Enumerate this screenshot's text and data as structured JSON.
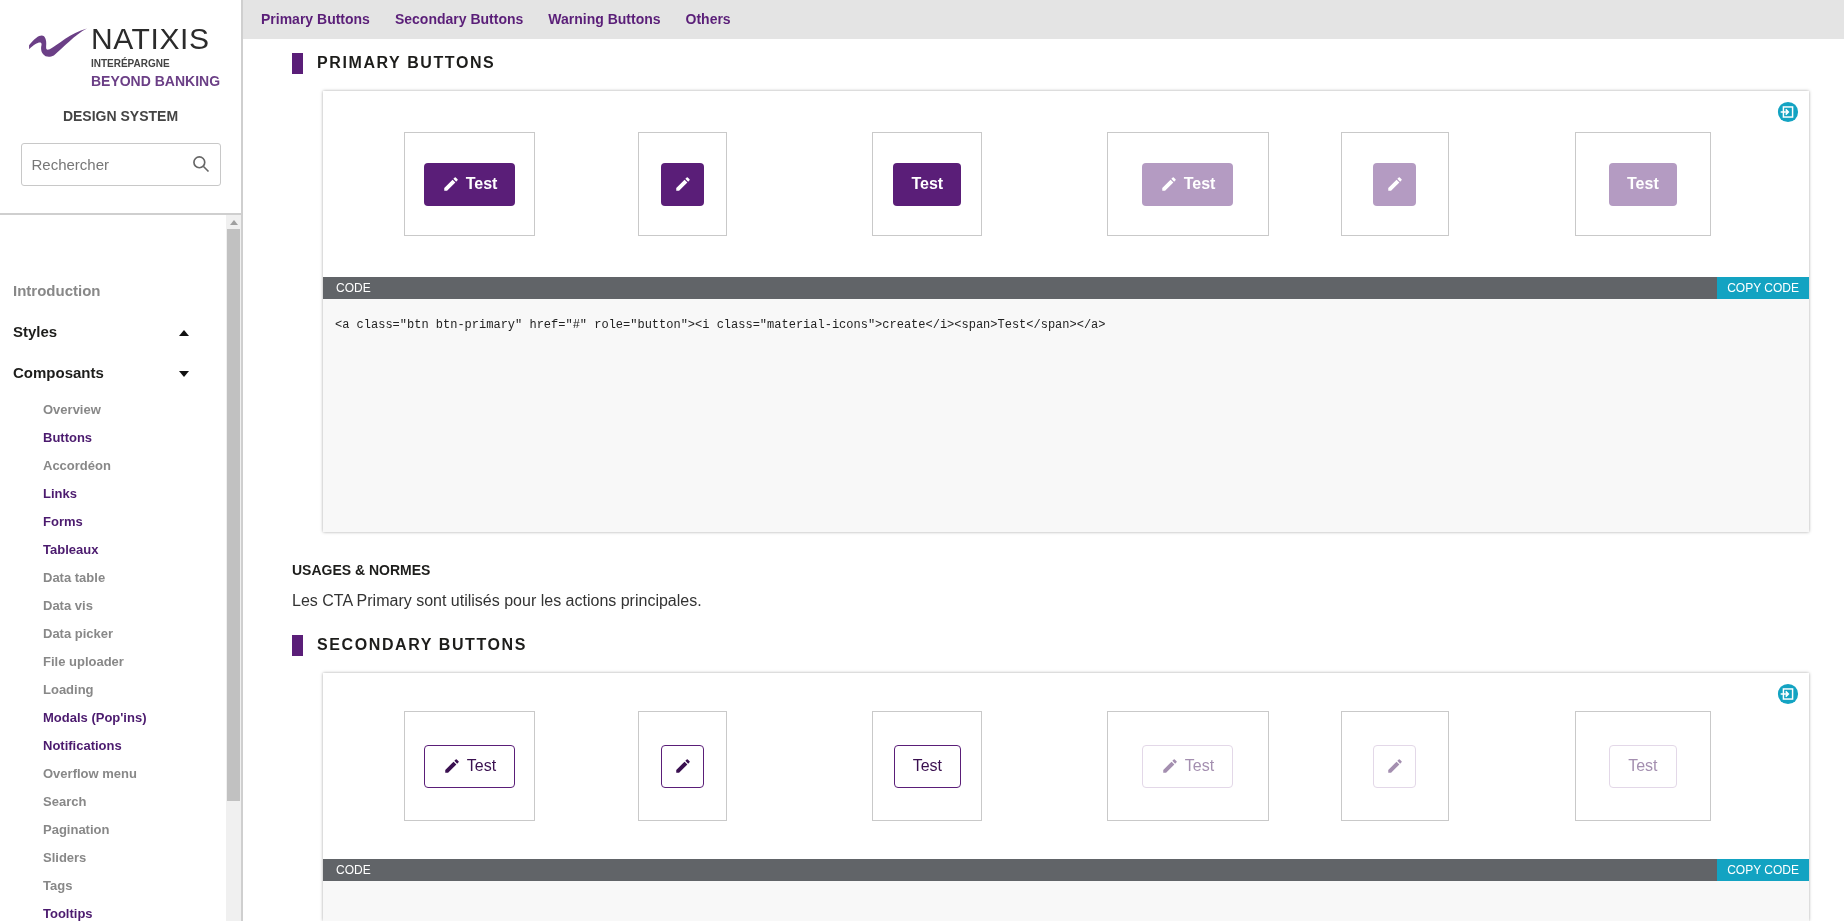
{
  "logo": {
    "name": "NATIXIS",
    "subtitle": "INTERÉPARGNE",
    "tagline": "BEYOND BANKING"
  },
  "sidebar": {
    "title": "DESIGN SYSTEM",
    "search": {
      "placeholder": "Rechercher"
    },
    "items": [
      {
        "kind": "link",
        "label": "Introduction"
      },
      {
        "kind": "group",
        "label": "Styles",
        "expanded": false
      },
      {
        "kind": "group",
        "label": "Composants",
        "expanded": true,
        "children": [
          {
            "label": "Overview",
            "visited": false
          },
          {
            "label": "Buttons",
            "visited": true
          },
          {
            "label": "Accordéon",
            "visited": false
          },
          {
            "label": "Links",
            "visited": true
          },
          {
            "label": "Forms",
            "visited": true
          },
          {
            "label": "Tableaux",
            "visited": true
          },
          {
            "label": "Data table",
            "visited": false
          },
          {
            "label": "Data vis",
            "visited": false
          },
          {
            "label": "Data picker",
            "visited": false
          },
          {
            "label": "File uploader",
            "visited": false
          },
          {
            "label": "Loading",
            "visited": false
          },
          {
            "label": "Modals (Pop'ins)",
            "visited": true
          },
          {
            "label": "Notifications",
            "visited": true
          },
          {
            "label": "Overflow menu",
            "visited": false
          },
          {
            "label": "Search",
            "visited": false
          },
          {
            "label": "Pagination",
            "visited": false
          },
          {
            "label": "Sliders",
            "visited": false
          },
          {
            "label": "Tags",
            "visited": false
          },
          {
            "label": "Tooltips",
            "visited": true
          }
        ]
      }
    ]
  },
  "top_nav": [
    "Primary Buttons",
    "Secondary Buttons",
    "Warning Buttons",
    "Others"
  ],
  "sections": [
    {
      "title": "PRIMARY BUTTONS",
      "kind": "primary",
      "demos": [
        {
          "kind": "icon_text",
          "label": "Test",
          "disabled": false
        },
        {
          "kind": "icon",
          "disabled": false
        },
        {
          "kind": "text",
          "label": "Test",
          "disabled": false
        },
        {
          "kind": "icon_text",
          "label": "Test",
          "disabled": true
        },
        {
          "kind": "icon",
          "disabled": true
        },
        {
          "kind": "text",
          "label": "Test",
          "disabled": true
        }
      ],
      "code_label": "CODE",
      "copy_label": "COPY CODE",
      "code": "<a class=\"btn btn-primary\" href=\"#\" role=\"button\"><i class=\"material-icons\">create</i><span>Test</span></a>",
      "usage_title": "USAGES & NORMES",
      "usage_text": "Les CTA Primary sont utilisés pour les actions principales."
    },
    {
      "title": "SECONDARY BUTTONS",
      "kind": "secondary",
      "demos": [
        {
          "kind": "icon_text",
          "label": "Test",
          "disabled": false
        },
        {
          "kind": "icon",
          "disabled": false
        },
        {
          "kind": "text",
          "label": "Test",
          "disabled": false
        },
        {
          "kind": "icon_text",
          "label": "Test",
          "disabled": true
        },
        {
          "kind": "icon",
          "disabled": true
        },
        {
          "kind": "text",
          "label": "Test",
          "disabled": true
        }
      ],
      "code_label": "CODE",
      "copy_label": "COPY CODE"
    }
  ]
}
